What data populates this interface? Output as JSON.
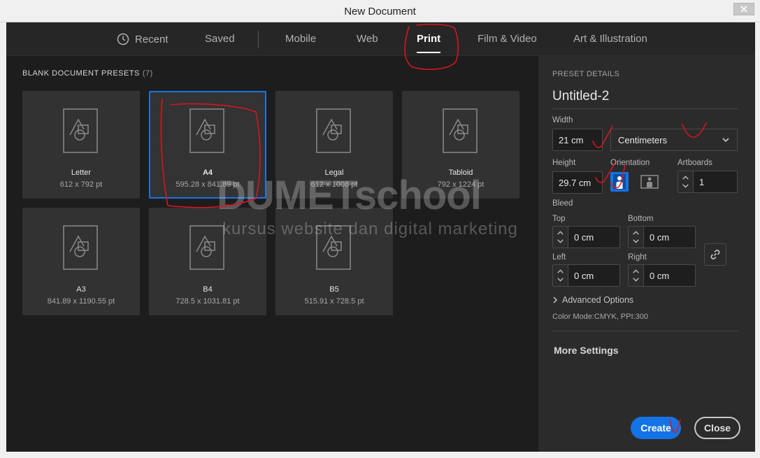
{
  "window": {
    "title": "New Document"
  },
  "tabs": [
    {
      "label": "Recent",
      "icon": "clock-icon"
    },
    {
      "label": "Saved"
    },
    {
      "label": "Mobile"
    },
    {
      "label": "Web"
    },
    {
      "label": "Print",
      "active": true
    },
    {
      "label": "Film & Video"
    },
    {
      "label": "Art & Illustration"
    }
  ],
  "presets": {
    "heading": "BLANK DOCUMENT PRESETS",
    "count": "(7)",
    "items": [
      {
        "name": "Letter",
        "size": "612 x 792 pt"
      },
      {
        "name": "A4",
        "size": "595.28 x 841.89 pt",
        "selected": true
      },
      {
        "name": "Legal",
        "size": "612 x 1008 pt"
      },
      {
        "name": "Tabloid",
        "size": "792 x 1224 pt"
      },
      {
        "name": "A3",
        "size": "841.89 x 1190.55 pt"
      },
      {
        "name": "B4",
        "size": "728.5 x 1031.81 pt"
      },
      {
        "name": "B5",
        "size": "515.91 x 728.5 pt"
      }
    ]
  },
  "details": {
    "heading": "PRESET DETAILS",
    "doc_name": "Untitled-2",
    "width_label": "Width",
    "width_value": "21 cm",
    "units_value": "Centimeters",
    "height_label": "Height",
    "height_value": "29.7 cm",
    "orientation_label": "Orientation",
    "orientation_selected": "portrait",
    "artboards_label": "Artboards",
    "artboards_value": "1",
    "bleed_label": "Bleed",
    "top_label": "Top",
    "top_value": "0 cm",
    "bottom_label": "Bottom",
    "bottom_value": "0 cm",
    "left_label": "Left",
    "left_value": "0 cm",
    "right_label": "Right",
    "right_value": "0 cm",
    "advanced_label": "Advanced Options",
    "color_mode": "Color Mode:CMYK, PPI:300",
    "more_settings": "More Settings",
    "create_label": "Create",
    "close_label": "Close"
  },
  "watermark": {
    "main": "DUMETschool",
    "sub": "kursus website dan digital marketing"
  },
  "colors": {
    "accent": "#1473e6",
    "selected_border": "#1a73e8",
    "annotation": "#e0141e",
    "dialog_bg": "#1d1d1d",
    "panel_bg": "#2b2b2b"
  }
}
